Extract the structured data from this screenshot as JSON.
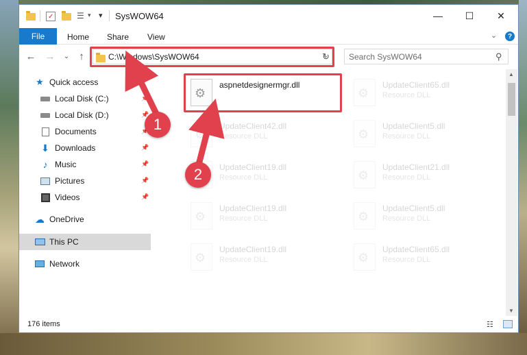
{
  "window": {
    "title": "SysWOW64",
    "minimize_glyph": "—",
    "maximize_glyph": "☐",
    "close_glyph": "✕"
  },
  "ribbon": {
    "tabs": [
      "File",
      "Home",
      "Share",
      "View"
    ],
    "help_glyph": "?",
    "expand_glyph": "⌄"
  },
  "address_bar": {
    "path": "C:\\Windows\\SysWOW64",
    "dropdown_glyph": "⌄",
    "refresh_glyph": "↻"
  },
  "nav": {
    "back_glyph": "←",
    "forward_glyph": "→",
    "recent_glyph": "⌄",
    "up_glyph": "↑"
  },
  "search": {
    "placeholder": "Search SysWOW64",
    "icon": "search-icon"
  },
  "sidebar": {
    "items": [
      {
        "label": "Quick access",
        "icon": "star-icon",
        "pinned": false
      },
      {
        "label": "Local Disk (C:)",
        "icon": "drive-icon",
        "pinned": true
      },
      {
        "label": "Local Disk (D:)",
        "icon": "drive-icon",
        "pinned": true
      },
      {
        "label": "Documents",
        "icon": "documents-icon",
        "pinned": true
      },
      {
        "label": "Downloads",
        "icon": "downloads-icon",
        "pinned": true
      },
      {
        "label": "Music",
        "icon": "music-icon",
        "pinned": true
      },
      {
        "label": "Pictures",
        "icon": "pictures-icon",
        "pinned": true
      },
      {
        "label": "Videos",
        "icon": "videos-icon",
        "pinned": true
      },
      {
        "label": "OneDrive",
        "icon": "cloud-icon",
        "pinned": false
      },
      {
        "label": "This PC",
        "icon": "computer-icon",
        "pinned": false,
        "selected": true
      },
      {
        "label": "Network",
        "icon": "network-icon",
        "pinned": false
      }
    ],
    "pin_glyph": "📌"
  },
  "files": [
    {
      "name": "aspnetdesignermgr.dll",
      "type": ""
    },
    {
      "name": "UpdateClient65.dll",
      "type": "Resource DLL"
    },
    {
      "name": "UpdateClient42.dll",
      "type": "Resource DLL"
    },
    {
      "name": "UpdateClient5.dll",
      "type": "Resource DLL"
    },
    {
      "name": "UpdateClient19.dll",
      "type": "Resource DLL"
    },
    {
      "name": "UpdateClient21.dll",
      "type": "Resource DLL"
    },
    {
      "name": "UpdateClient19.dll",
      "type": "Resource DLL"
    },
    {
      "name": "UpdateClient5.dll",
      "type": "Resource DLL"
    },
    {
      "name": "UpdateClient19.dll",
      "type": "Resource DLL"
    },
    {
      "name": "UpdateClient65.dll",
      "type": "Resource DLL"
    }
  ],
  "status": {
    "item_count": "176 items"
  },
  "annotations": {
    "badge_1": "1",
    "badge_2": "2",
    "color": "#e0414c"
  },
  "colors": {
    "accent": "#1979ca",
    "highlight": "#e0414c",
    "selected_bg": "#d9d9d9"
  }
}
